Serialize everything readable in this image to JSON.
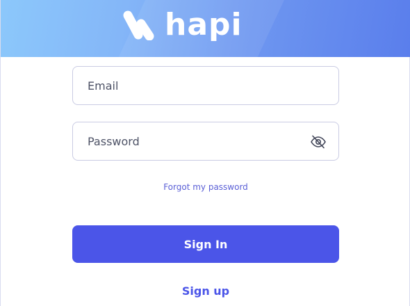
{
  "brand": {
    "name": "hapi",
    "logo_icon": "hapi-mark-icon"
  },
  "form": {
    "email_placeholder": "Email",
    "password_placeholder": "Password",
    "password_toggle_icon": "eye-slash-icon",
    "forgot_label": "Forgot my password",
    "signin_label": "Sign In",
    "signup_label": "Sign up"
  },
  "colors": {
    "accent": "#4b55e8",
    "link": "#5a5fd6",
    "header_start": "#8cc8fb",
    "header_end": "#5a7eec"
  }
}
